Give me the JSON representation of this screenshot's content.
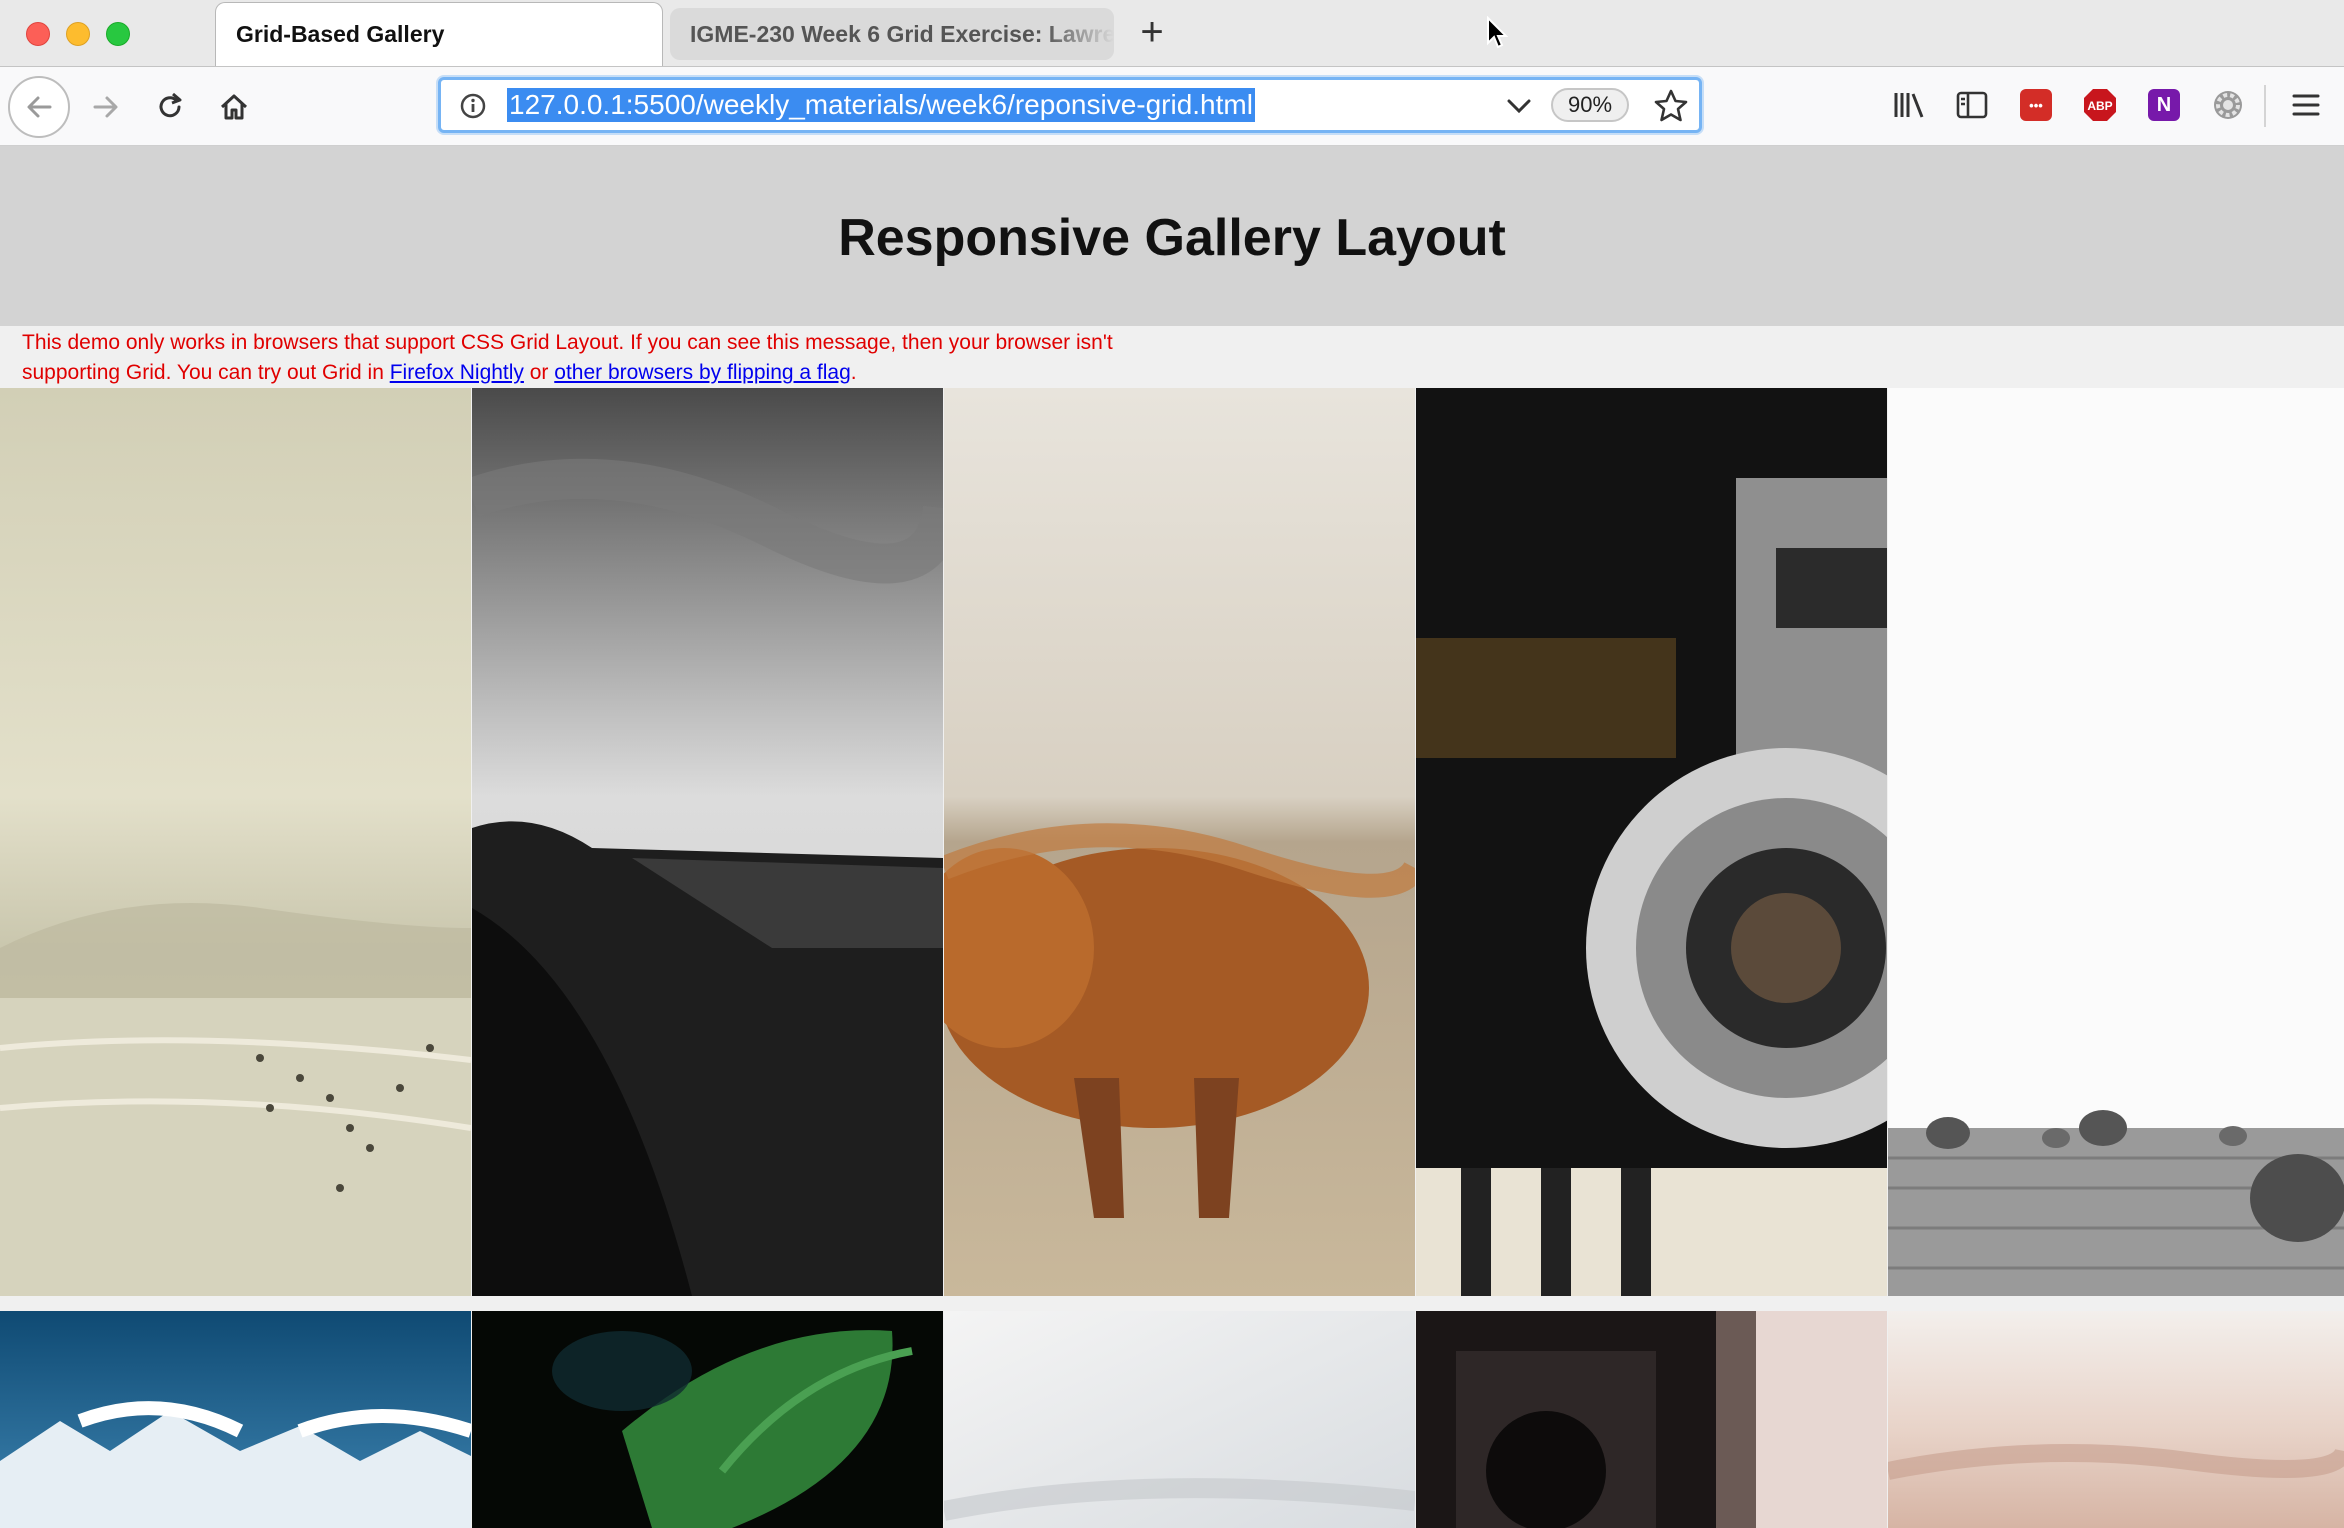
{
  "browser": {
    "tabs": [
      {
        "label": "Grid-Based Gallery",
        "active": true
      },
      {
        "label": "IGME-230 Week 6 Grid Exercise: Lawrence",
        "active": false
      }
    ],
    "new_tab_label": "+",
    "url": "127.0.0.1:5500/weekly_materials/week6/reponsive-grid.html",
    "zoom": "90%",
    "toolbar_icons": [
      "back-icon",
      "forward-icon",
      "reload-icon",
      "home-icon",
      "info-icon",
      "dropdown-icon",
      "bookmark-star-icon",
      "library-icon",
      "sidebar-icon",
      "lastpass-icon",
      "adblock-icon",
      "onenote-icon",
      "extension-gear-icon",
      "hamburger-menu-icon"
    ],
    "extensions": {
      "lastpass": "•••",
      "adblock": "ABP",
      "onenote": "N"
    }
  },
  "page": {
    "title": "Responsive Gallery Layout",
    "notice": {
      "text_1": "This demo only works in browsers that support CSS Grid Layout. If you can see this message, then your browser isn't supporting Grid. You can try out Grid in ",
      "link_1": "Firefox Nightly",
      "text_2": " or ",
      "link_2": "other browsers by flipping a flag",
      "text_3": "."
    },
    "gallery": {
      "row_1": [
        "beach-photo",
        "cliff-bw-photo",
        "highland-cow-photo",
        "vintage-camera-photo",
        "hay-bales-photo"
      ],
      "row_2": [
        "mountain-photo",
        "leaf-photo",
        "sky-photo",
        "camera-closeup-photo",
        "sunset-photo"
      ]
    }
  },
  "colors": {
    "notice": "#e00000",
    "link": "#0000ee",
    "header_bg": "#d3d3d3",
    "url_highlight": "#3b8cf1"
  }
}
